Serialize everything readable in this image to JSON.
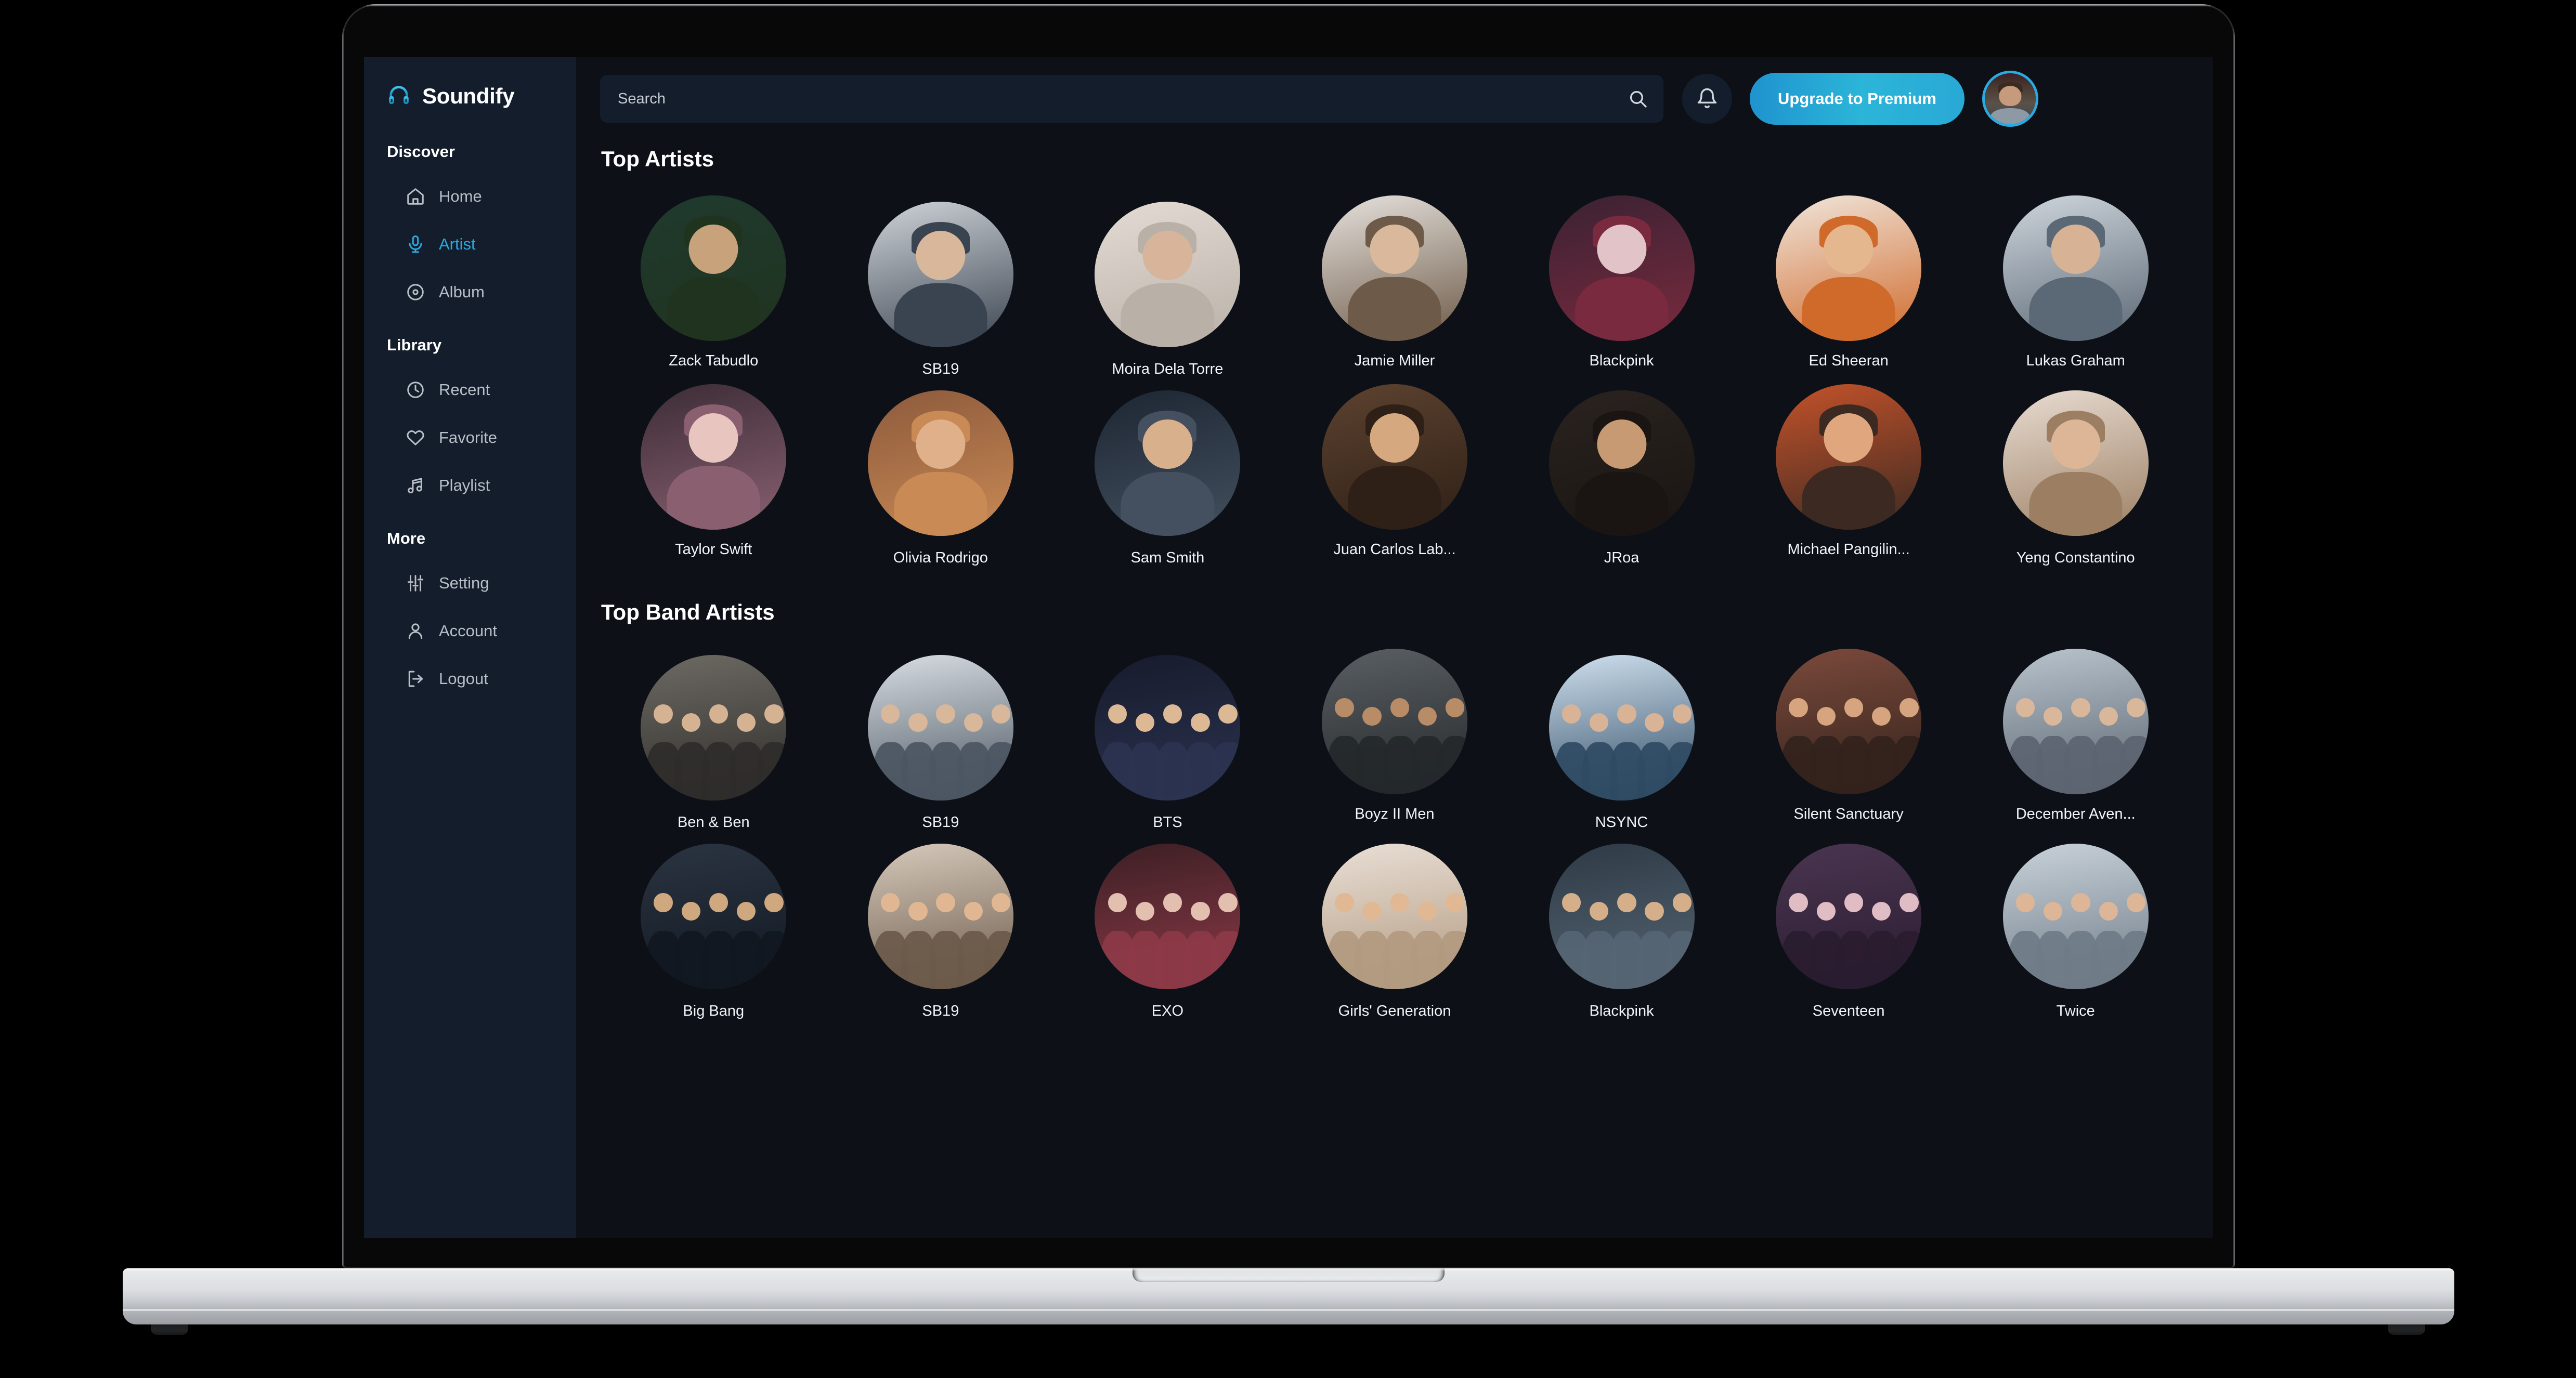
{
  "app": {
    "brand_name": "Soundify",
    "brand_icon": "headphones-icon",
    "accent_color": "#29ABE2",
    "sidebar_bg": "#141D2B",
    "main_bg": "#0D1117"
  },
  "sidebar": {
    "groups": [
      {
        "title": "Discover",
        "items": [
          {
            "label": "Home",
            "icon": "home-icon",
            "active": false
          },
          {
            "label": "Artist",
            "icon": "microphone-icon",
            "active": true
          },
          {
            "label": "Album",
            "icon": "disc-icon",
            "active": false
          }
        ]
      },
      {
        "title": "Library",
        "items": [
          {
            "label": "Recent",
            "icon": "clock-icon",
            "active": false
          },
          {
            "label": "Favorite",
            "icon": "heart-icon",
            "active": false
          },
          {
            "label": "Playlist",
            "icon": "music-notes-icon",
            "active": false
          }
        ]
      },
      {
        "title": "More",
        "items": [
          {
            "label": "Setting",
            "icon": "sliders-icon",
            "active": false
          },
          {
            "label": "Account",
            "icon": "user-icon",
            "active": false
          },
          {
            "label": "Logout",
            "icon": "logout-icon",
            "active": false
          }
        ]
      }
    ]
  },
  "topbar": {
    "search_placeholder": "Search",
    "search_value": "",
    "search_icon": "search-icon",
    "notification_icon": "bell-icon",
    "upgrade_label": "Upgrade to Premium",
    "avatar": "user-avatar"
  },
  "sections": [
    {
      "title": "Top Artists",
      "rows": [
        [
          {
            "name": "Zack Tabudlo",
            "raised": true
          },
          {
            "name": "SB19",
            "raised": false
          },
          {
            "name": "Moira Dela Torre",
            "raised": false
          },
          {
            "name": "Jamie Miller",
            "raised": true
          },
          {
            "name": "Blackpink",
            "raised": true
          },
          {
            "name": "Ed Sheeran",
            "raised": true
          },
          {
            "name": "Lukas Graham",
            "raised": true
          }
        ],
        [
          {
            "name": "Taylor Swift",
            "raised": true
          },
          {
            "name": "Olivia Rodrigo",
            "raised": false
          },
          {
            "name": "Sam Smith",
            "raised": false
          },
          {
            "name": "Juan Carlos Lab...",
            "raised": true
          },
          {
            "name": "JRoa",
            "raised": false
          },
          {
            "name": "Michael Pangilin...",
            "raised": true
          },
          {
            "name": "Yeng Constantino",
            "raised": false
          }
        ]
      ]
    },
    {
      "title": "Top Band Artists",
      "rows": [
        [
          {
            "name": "Ben & Ben",
            "raised": false
          },
          {
            "name": "SB19",
            "raised": false
          },
          {
            "name": "BTS",
            "raised": false
          },
          {
            "name": "Boyz II Men",
            "raised": true
          },
          {
            "name": "NSYNC",
            "raised": false
          },
          {
            "name": "Silent Sanctuary",
            "raised": true
          },
          {
            "name": "December Aven...",
            "raised": true
          }
        ],
        [
          {
            "name": "Big Bang",
            "raised": false
          },
          {
            "name": "SB19",
            "raised": false
          },
          {
            "name": "EXO",
            "raised": false
          },
          {
            "name": "Girls' Generation",
            "raised": false
          },
          {
            "name": "Blackpink",
            "raised": false
          },
          {
            "name": "Seventeen",
            "raised": false
          },
          {
            "name": "Twice",
            "raised": false
          }
        ]
      ]
    }
  ]
}
